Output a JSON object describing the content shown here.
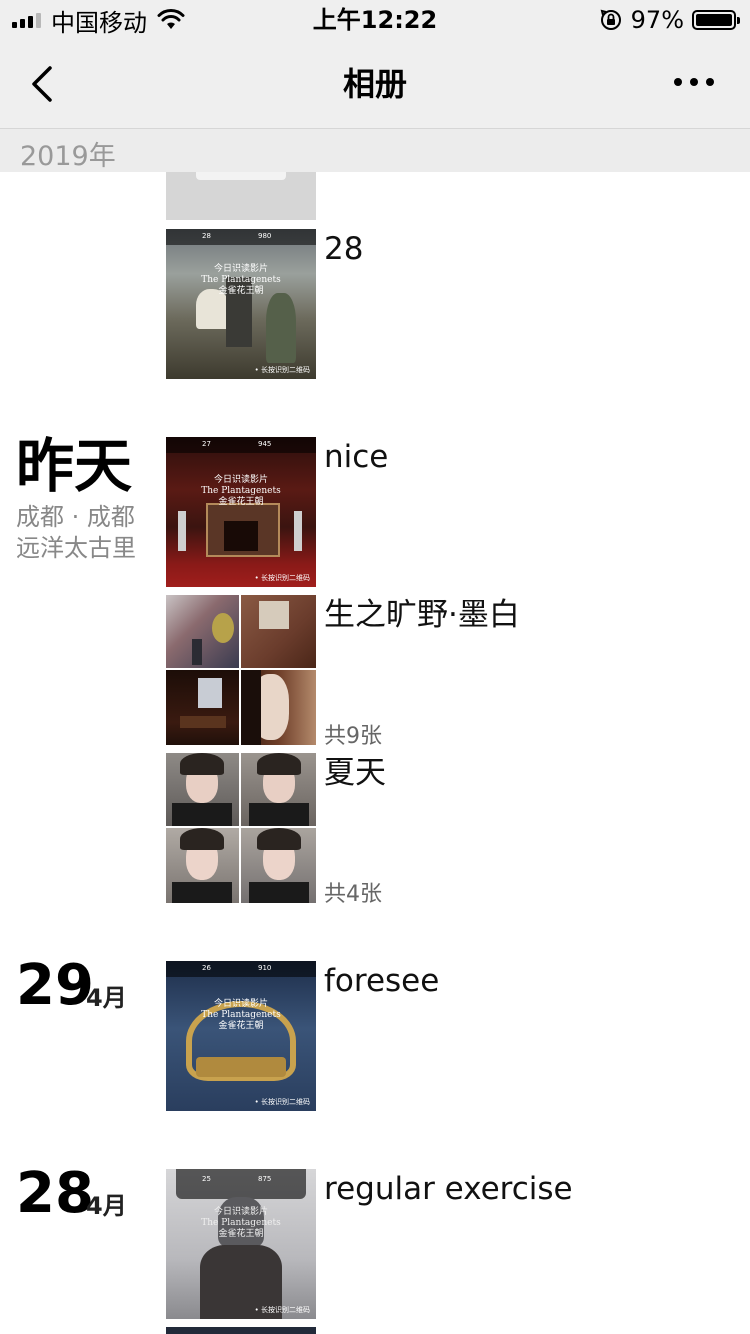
{
  "status_bar": {
    "carrier": "中国移动",
    "time": "上午12:22",
    "battery_percent": "97%",
    "battery_level": 0.97
  },
  "nav": {
    "title": "相册"
  },
  "year_header": "2019年",
  "entries": [
    {
      "text": "28"
    },
    {
      "date": "昨天",
      "location_line1": "成都 · 成都",
      "location_line2": "远洋太古里",
      "text": "nice"
    },
    {
      "text": "生之旷野·墨白",
      "count": "共9张"
    },
    {
      "text": "夏天",
      "count": "共4张"
    },
    {
      "day": "29",
      "month": "4月",
      "text": "foresee"
    },
    {
      "day": "28",
      "month": "4月",
      "text": "regular exercise"
    }
  ],
  "poster": {
    "title_cn": "今日识读影片",
    "title_en": "The Plantagenets",
    "subtitle_cn": "金雀花王朝",
    "scan_text": "• 长按识别二维码",
    "day_labels": [
      "28",
      "27",
      "26",
      "25"
    ],
    "word_counts": [
      "980",
      "945",
      "910",
      "875"
    ]
  },
  "colors": {
    "bar_bg": "#efefef",
    "year_bg": "#ececec",
    "muted_text": "#888888"
  }
}
